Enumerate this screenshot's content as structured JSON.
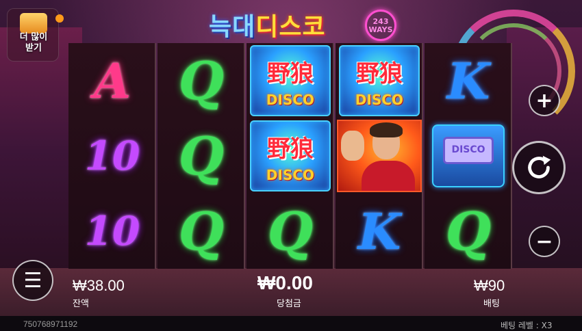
{
  "game": {
    "title_part1": "늑대",
    "title_part2": "디스코",
    "ways_badge": "243 WAYS"
  },
  "promo": {
    "more_get_label_line1": "더 많이",
    "more_get_label_line2": "받기"
  },
  "reels": [
    {
      "symbols": [
        "A",
        "10",
        "10"
      ]
    },
    {
      "symbols": [
        "Q",
        "Q",
        "Q"
      ]
    },
    {
      "symbols": [
        "wild",
        "wild",
        "Q"
      ]
    },
    {
      "symbols": [
        "wild",
        "singer",
        "K"
      ]
    },
    {
      "symbols": [
        "K",
        "pager",
        "Q"
      ]
    }
  ],
  "wild_symbol": {
    "text_cn": "野狼",
    "text_en": "DISCO"
  },
  "pager_symbol": {
    "screen_text": "DISCO"
  },
  "controls": {
    "plus_icon": "+",
    "minus_icon": "−",
    "menu_icon": "☰",
    "spin_icon": "refresh-icon"
  },
  "stats": {
    "balance_value": "₩38.00",
    "balance_label": "잔액",
    "win_value": "₩0.00",
    "win_label": "당첨금",
    "bet_value": "₩90",
    "bet_label": "배팅"
  },
  "footer": {
    "session_id": "750768971192",
    "bet_level": "베팅 레벨 : X3"
  },
  "colors": {
    "A": "#ff3a8a",
    "Q": "#3fe05a",
    "10": "#c44aff",
    "K": "#2a8cff"
  }
}
